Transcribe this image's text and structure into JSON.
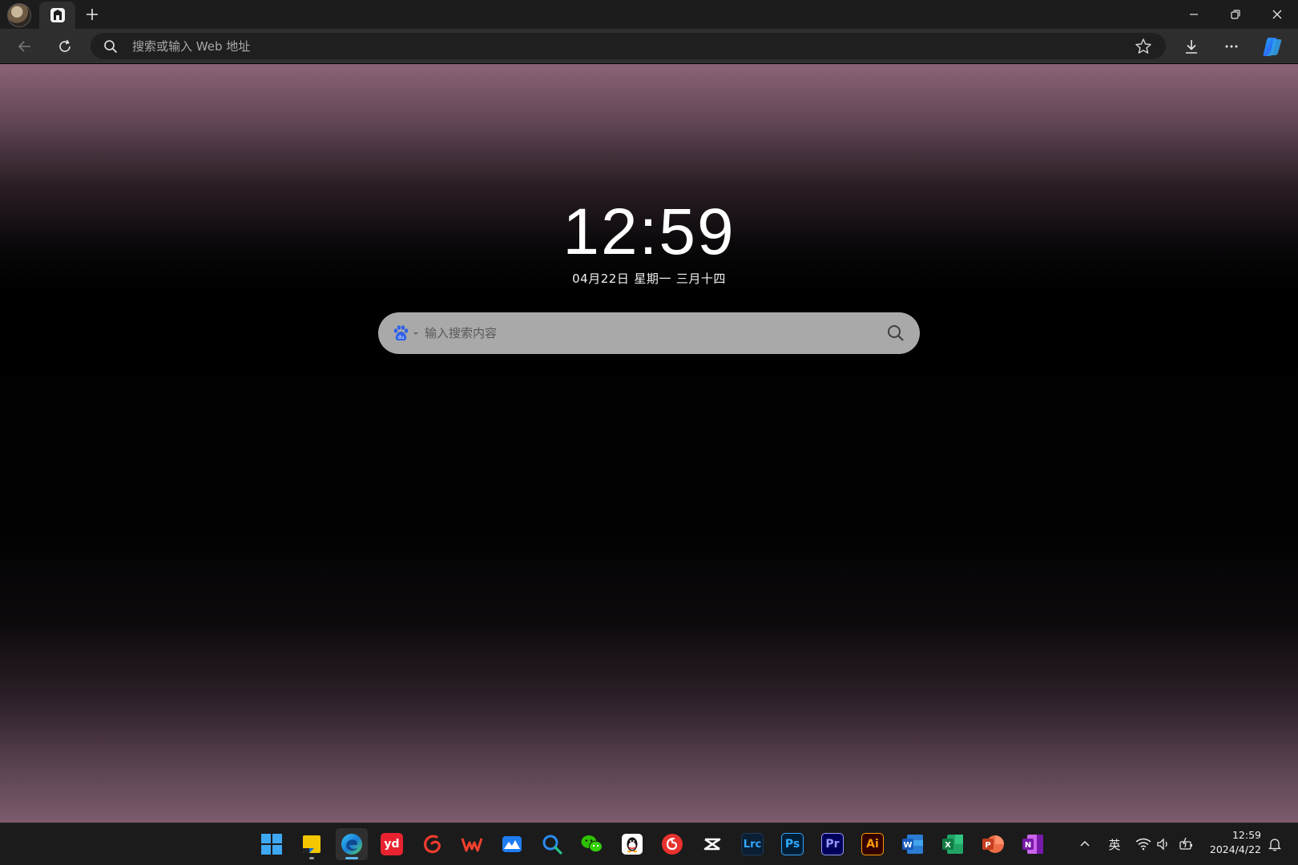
{
  "browser": {
    "address_placeholder": "搜索或输入 Web 地址"
  },
  "newtab": {
    "time": "12:59",
    "date": "04月22日",
    "weekday": "星期一",
    "lunar_date": "三月十四",
    "search_placeholder": "输入搜索内容",
    "search_engine_icon": "baidu-paw-icon"
  },
  "taskbar": {
    "apps": [
      {
        "name": "start",
        "icon": "windows-start-icon"
      },
      {
        "name": "sticky-notes",
        "icon": "sticky-notes-icon",
        "running": true
      },
      {
        "name": "edge",
        "icon": "edge-icon",
        "active": true
      },
      {
        "name": "youdao-dict",
        "icon": "youdao-icon",
        "label": "yd"
      },
      {
        "name": "xmind",
        "icon": "red-swirl-app-icon"
      },
      {
        "name": "wps-office",
        "icon": "wps-icon",
        "label": "W"
      },
      {
        "name": "feishu-like",
        "icon": "blue-wave-app-icon"
      },
      {
        "name": "search-app",
        "icon": "magnifier-app-icon"
      },
      {
        "name": "wechat",
        "icon": "wechat-icon"
      },
      {
        "name": "qq",
        "icon": "qq-penguin-icon"
      },
      {
        "name": "netease-music",
        "icon": "netease-music-icon"
      },
      {
        "name": "capcut",
        "icon": "capcut-icon"
      },
      {
        "name": "lightroom-classic",
        "icon": "lightroom-icon",
        "label": "Lrc"
      },
      {
        "name": "photoshop",
        "icon": "photoshop-icon",
        "label": "Ps"
      },
      {
        "name": "premiere",
        "icon": "premiere-icon",
        "label": "Pr"
      },
      {
        "name": "illustrator",
        "icon": "illustrator-icon",
        "label": "Ai"
      },
      {
        "name": "word",
        "icon": "word-icon",
        "label": "W"
      },
      {
        "name": "excel",
        "icon": "excel-icon",
        "label": "X"
      },
      {
        "name": "powerpoint",
        "icon": "powerpoint-icon",
        "label": "P"
      },
      {
        "name": "onenote",
        "icon": "onenote-icon",
        "label": "N"
      }
    ],
    "tray": {
      "ime_label": "英",
      "time": "12:59",
      "date": "2024/4/22"
    }
  },
  "colors": {
    "accent": "#5bb7f0",
    "page_top": "#8a6476",
    "search_bg": "#a9a9a9",
    "lrc": "#31a8ff",
    "ps": "#31a8ff",
    "pr": "#9999ff",
    "ai": "#ff9a00"
  }
}
